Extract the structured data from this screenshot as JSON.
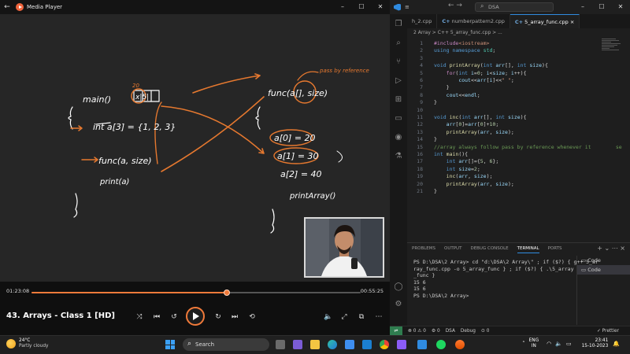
{
  "media_player": {
    "title": "Media Player",
    "video_title": "43. Arrays - Class 1 [HD]",
    "elapsed": "01:23:08",
    "remaining": "00:55:25",
    "progress_fraction": 0.594,
    "accent": "#f07a3a"
  },
  "whiteboard": {
    "main_label": "main()",
    "decl": "int a[3] = {1, 2, 3}",
    "call": "func(a, size)",
    "print": "print(a)",
    "box_nums": "20",
    "cells": "x|5|",
    "func_sig": "func(a[], size)",
    "note": "pass by reference",
    "a0": "a[0] = 20",
    "a1": "a[1] = 30",
    "a2": "a[2] = 40",
    "print_array": "printArray()",
    "ink": "#ffffff",
    "pen": "#e5782f"
  },
  "vscode": {
    "menu": [
      "≡"
    ],
    "search_text": "DSA",
    "tabs": [
      {
        "label": "h_2.cpp"
      },
      {
        "label": "numberpattern2.cpp"
      },
      {
        "label": "5_array_func.cpp",
        "active": true
      }
    ],
    "breadcrumb": "2 Array > C++ 5_array_func.cpp > ...",
    "code_lines": [
      {
        "n": "1",
        "html": "<span class='ct'>#include</span><span class='st'>&lt;iostream&gt;</span>"
      },
      {
        "n": "2",
        "html": "<span class='kw'>using namespace</span> <span class='ty'>std</span>;"
      },
      {
        "n": "3",
        "html": ""
      },
      {
        "n": "4",
        "html": "<span class='kw'>void</span> <span class='fn'>printArray</span>(<span class='kw'>int</span> <span class='vr'>arr</span>[], <span class='kw'>int</span> <span class='vr'>size</span>){"
      },
      {
        "n": "5",
        "html": "    <span class='ct'>for</span>(<span class='kw'>int</span> <span class='vr'>i</span>=<span class='num'>0</span>; <span class='vr'>i</span>&lt;<span class='vr'>size</span>; <span class='vr'>i</span>++){"
      },
      {
        "n": "6",
        "html": "        <span class='vr'>cout</span>&lt;&lt;<span class='vr'>arr</span>[<span class='vr'>i</span>]&lt;&lt;<span class='st'>\" \"</span>;"
      },
      {
        "n": "7",
        "html": "    }"
      },
      {
        "n": "8",
        "html": "    <span class='vr'>cout</span>&lt;&lt;<span class='vr'>endl</span>;"
      },
      {
        "n": "9",
        "html": "}"
      },
      {
        "n": "10",
        "html": ""
      },
      {
        "n": "11",
        "html": "<span class='kw'>void</span> <span class='fn'>inc</span>(<span class='kw'>int</span> <span class='vr'>arr</span>[], <span class='kw'>int</span> <span class='vr'>size</span>){"
      },
      {
        "n": "12",
        "html": "    <span class='vr'>arr</span>[<span class='num'>0</span>]=<span class='vr'>arr</span>[<span class='num'>0</span>]+<span class='num'>10</span>;"
      },
      {
        "n": "13",
        "html": "    <span class='fn'>printArray</span>(<span class='vr'>arr</span>, <span class='vr'>size</span>);"
      },
      {
        "n": "14",
        "html": "}"
      },
      {
        "n": "15",
        "html": "<span class='cm'>//array always follow pass by reference whenever it        se</span>"
      },
      {
        "n": "16",
        "html": "<span class='kw'>int</span> <span class='fn'>main</span>(){"
      },
      {
        "n": "17",
        "html": "    <span class='kw'>int</span> <span class='vr'>arr</span>[]={<span class='num'>5</span>, <span class='num'>6</span>};"
      },
      {
        "n": "18",
        "html": "    <span class='kw'>int</span> <span class='vr'>size</span>=<span class='num'>2</span>;"
      },
      {
        "n": "19",
        "html": "    <span class='fn'>inc</span>(<span class='vr'>arr</span>, <span class='vr'>size</span>);"
      },
      {
        "n": "20",
        "html": "    <span class='fn'>printArray</span>(<span class='vr'>arr</span>, <span class='vr'>size</span>);"
      },
      {
        "n": "21",
        "html": "}"
      }
    ],
    "panel_tabs": [
      "PROBLEMS",
      "OUTPUT",
      "DEBUG CONSOLE",
      "TERMINAL",
      "PORTS"
    ],
    "active_panel_tab": "TERMINAL",
    "terminal_lines": [
      "PS D:\\DSA\\2 Array> cd \"d:\\DSA\\2 Array\\\" ; if ($?) { g++ 5_ar",
      "ray_func.cpp -o 5_array_func } ; if ($?) { .\\5_array",
      "_func }",
      "15 6",
      "15 6",
      "PS D:\\DSA\\2 Array>"
    ],
    "terminal_sessions": [
      "Code",
      "Code"
    ],
    "status": {
      "errors": "⊗ 0 ⚠ 0",
      "warn2": "⚙ 0",
      "folder": "DSA",
      "debug": "Debug",
      "ports": "⊙ 0",
      "prettier": "✓ Prettier"
    }
  },
  "taskbar": {
    "temp": "24°C",
    "weather": "Partly cloudy",
    "search": "Search",
    "lang1": "ENG",
    "lang2": "IN",
    "time": "23:41",
    "date": "15-10-2023"
  }
}
